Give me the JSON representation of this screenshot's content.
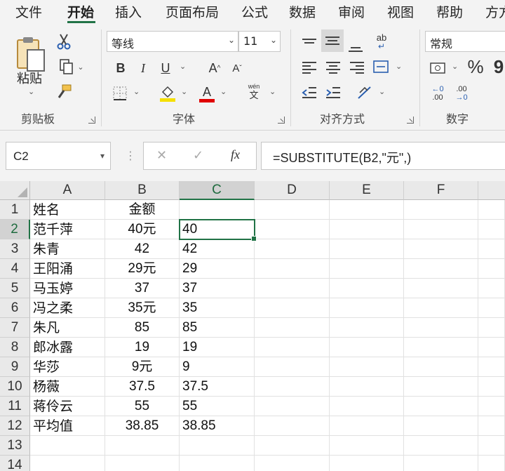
{
  "tabs": [
    "文件",
    "开始",
    "插入",
    "页面布局",
    "公式",
    "数据",
    "审阅",
    "视图",
    "帮助",
    "方方"
  ],
  "active_tab": "开始",
  "ribbon": {
    "clipboard": {
      "paste_label": "粘贴",
      "group_label": "剪贴板"
    },
    "font": {
      "font_name": "等线",
      "font_size": "11",
      "bold": "B",
      "italic": "I",
      "underline": "U",
      "grow": "A",
      "shrink": "A",
      "font_color_letter": "A",
      "phonetic_top": "wén",
      "phonetic_bottom": "文",
      "group_label": "字体",
      "fill_color": "#f5e000",
      "font_color": "#e00000"
    },
    "alignment": {
      "wrap_glyph": "ab",
      "group_label": "对齐方式"
    },
    "number": {
      "format": "常规",
      "percent": "%",
      "comma": "9",
      "inc_decimal_top": "←0",
      "inc_decimal_bottom": ".00",
      "dec_decimal_top": ".00",
      "dec_decimal_bottom": "→0",
      "group_label": "数字"
    }
  },
  "formula_bar": {
    "name_box": "C2",
    "cancel": "✕",
    "enter": "✓",
    "fx": "fx",
    "formula": "=SUBSTITUTE(B2,\"元\",)"
  },
  "grid": {
    "columns": [
      "A",
      "B",
      "C",
      "D",
      "E",
      "F"
    ],
    "selected_column": "C",
    "selected_row": "2",
    "rows": [
      {
        "n": "1",
        "a": "姓名",
        "b": "金额",
        "c": ""
      },
      {
        "n": "2",
        "a": "范千萍",
        "b": "40元",
        "c": "40"
      },
      {
        "n": "3",
        "a": "朱青",
        "b": "42",
        "c": "42"
      },
      {
        "n": "4",
        "a": "王阳涌",
        "b": "29元",
        "c": "29"
      },
      {
        "n": "5",
        "a": "马玉婷",
        "b": "37",
        "c": "37"
      },
      {
        "n": "6",
        "a": "冯之柔",
        "b": "35元",
        "c": "35"
      },
      {
        "n": "7",
        "a": "朱凡",
        "b": "85",
        "c": "85"
      },
      {
        "n": "8",
        "a": "郎冰露",
        "b": "19",
        "c": "19"
      },
      {
        "n": "9",
        "a": "华莎",
        "b": "9元",
        "c": "9"
      },
      {
        "n": "10",
        "a": "杨薇",
        "b": "37.5",
        "c": "37.5"
      },
      {
        "n": "11",
        "a": "蒋伶云",
        "b": "55",
        "c": "55"
      },
      {
        "n": "12",
        "a": "平均值",
        "b": "38.85",
        "c": "38.85"
      },
      {
        "n": "13",
        "a": "",
        "b": "",
        "c": ""
      },
      {
        "n": "14",
        "a": "",
        "b": "",
        "c": ""
      }
    ]
  }
}
